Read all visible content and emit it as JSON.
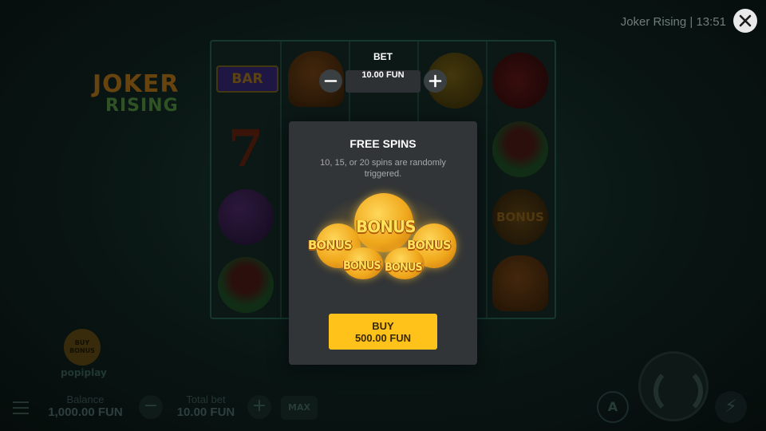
{
  "game": {
    "logo_line1": "JOKER",
    "logo_line2": "RISING",
    "buy_bonus_badge": [
      "BUY",
      "BONUS"
    ],
    "provider": "popiplay",
    "reel_symbols": {
      "bar": "BAR",
      "seven": "7",
      "bonus": "BONUS"
    }
  },
  "header": {
    "title_time": "Joker Rising | 13:51",
    "close_icon": "close-icon"
  },
  "bet_selector": {
    "label": "BET",
    "value": "10.00 FUN",
    "minus_icon": "minus-icon",
    "plus_icon": "plus-icon"
  },
  "free_spins_panel": {
    "title": "FREE SPINS",
    "description": "10, 15, or 20 spins are randomly triggered.",
    "artwork_words": [
      "BONUS",
      "BONUS",
      "BONUS",
      "BONUS",
      "BONUS"
    ],
    "buy_label": "BUY",
    "buy_price": "500.00 FUN"
  },
  "bottom_bar": {
    "balance_label": "Balance",
    "balance_value": "1,000.00 FUN",
    "total_bet_label": "Total bet",
    "total_bet_value": "10.00 FUN",
    "max_label": "MAX",
    "autoplay_label": "A",
    "minus_symbol": "−",
    "plus_symbol": "+",
    "turbo_symbol": "⚡"
  },
  "colors": {
    "buy_button": "#ffc21a",
    "panel_bg": "#323537",
    "bet_button_bg": "#3a3f42"
  }
}
